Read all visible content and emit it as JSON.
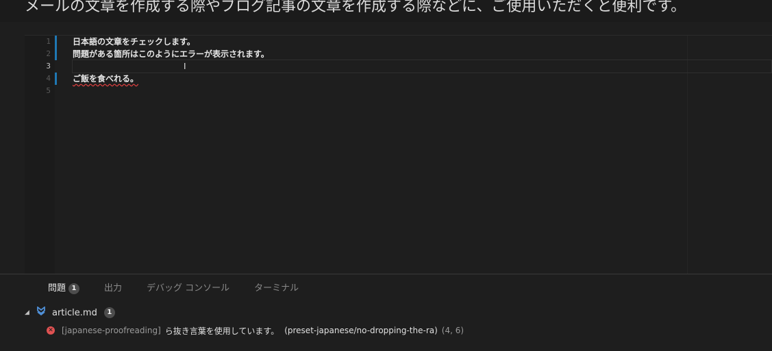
{
  "caption": "メールの文章を作成する際やブログ記事の文章を作成する際などに、ご使用いただくと便利です。",
  "editor": {
    "lines": [
      {
        "num": "1",
        "text": "日本語の文章をチェックします。"
      },
      {
        "num": "2",
        "text": "問題がある箇所はこのようにエラーが表示されます。"
      },
      {
        "num": "3",
        "text": ""
      },
      {
        "num": "4",
        "text": "ご飯を食べれる。"
      },
      {
        "num": "5",
        "text": ""
      }
    ],
    "cursor_glyph": "I"
  },
  "panel": {
    "tabs": [
      {
        "label": "問題",
        "badge": "1"
      },
      {
        "label": "出力"
      },
      {
        "label": "デバッグ コンソール"
      },
      {
        "label": "ターミナル"
      }
    ],
    "file": {
      "name": "article.md",
      "count": "1",
      "twisty": "◢",
      "icon": "markdown-icon"
    },
    "problem": {
      "icon": "error-icon",
      "icon_glyph": "✕",
      "source": "[japanese-proofreading]",
      "message": "ら抜き言葉を使用しています。",
      "rule": "(preset-japanese/no-dropping-the-ra)",
      "location": "(4, 6)"
    }
  },
  "colors": {
    "modified_bar": "#1f78b4",
    "error": "#e05252",
    "squiggle": "#e04040"
  }
}
